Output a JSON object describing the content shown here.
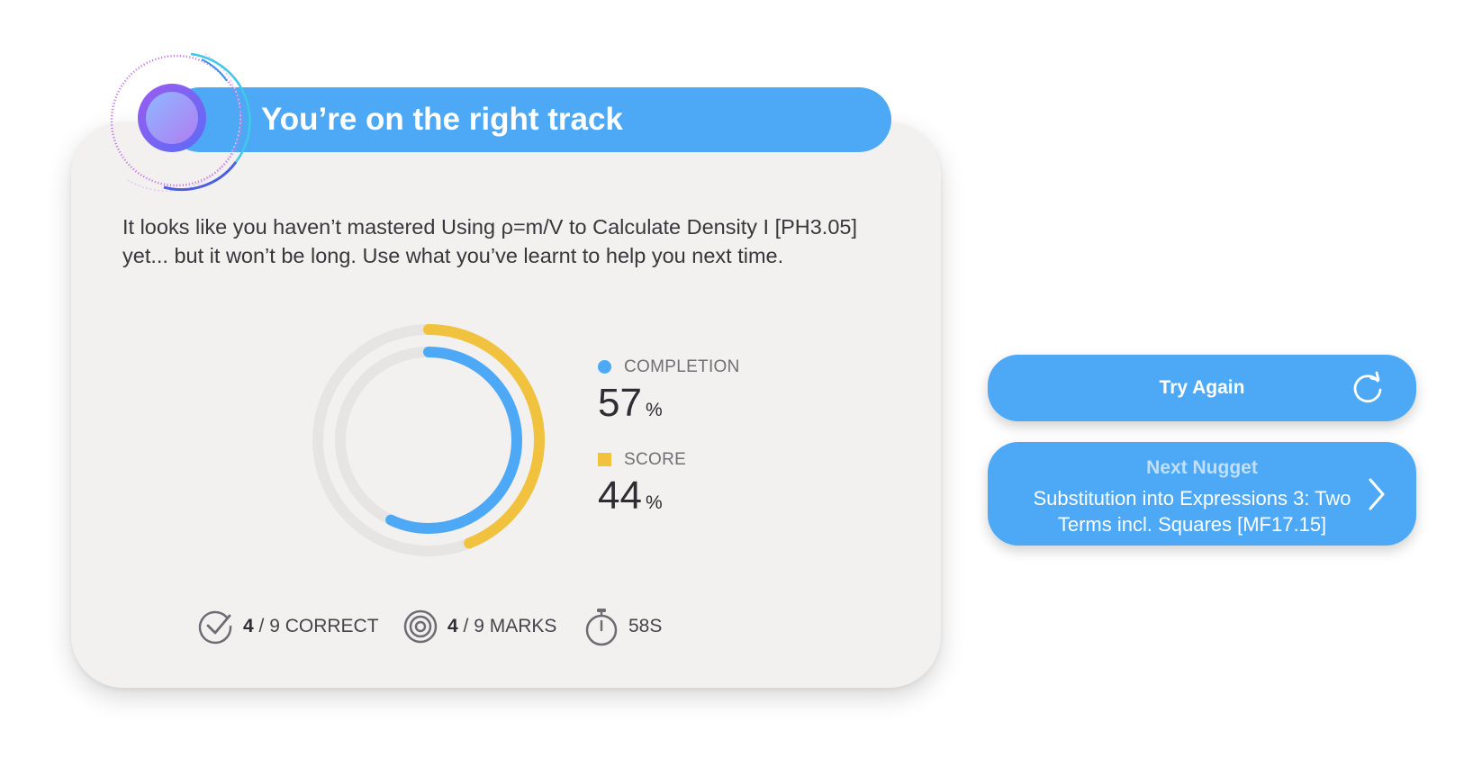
{
  "header": {
    "title": "You’re on the right track"
  },
  "message": "It looks like you haven’t mastered Using ρ=m/V to Calculate Density I [PH3.05] yet... but it won’t be long. Use what you’ve learnt to help you next time.",
  "metrics": {
    "completion": {
      "label": "COMPLETION",
      "value": "57",
      "unit": "%",
      "fraction": 0.57,
      "color": "#4da9f5"
    },
    "score": {
      "label": "SCORE",
      "value": "44",
      "unit": "%",
      "fraction": 0.44,
      "color": "#f1c23d"
    }
  },
  "stats": {
    "correct": {
      "count": "4",
      "rest": " / 9 CORRECT",
      "icon": "check-circle-icon"
    },
    "marks": {
      "count": "4",
      "rest": " / 9 MARKS",
      "icon": "target-icon"
    },
    "time": {
      "text": "58S",
      "icon": "stopwatch-icon"
    }
  },
  "actions": {
    "try_again": {
      "label": "Try Again",
      "icon": "refresh-icon"
    },
    "next_nugget": {
      "kicker": "Next Nugget",
      "title": "Substitution into Expressions 3: Two Terms incl. Squares [MF17.15]",
      "icon": "chevron-right-icon"
    }
  }
}
